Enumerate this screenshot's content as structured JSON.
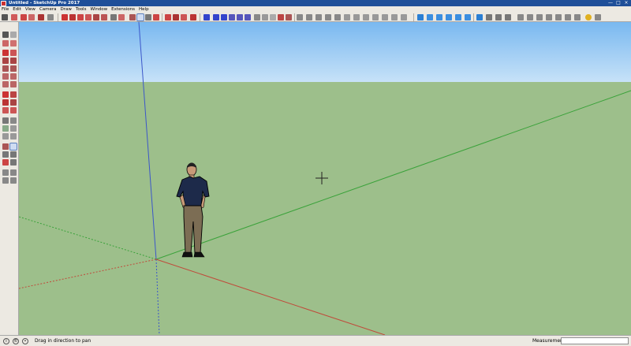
{
  "window": {
    "title": "Untitled - SketchUp Pro 2017",
    "controls": [
      "—",
      "□",
      "×"
    ]
  },
  "menu": [
    "File",
    "Edit",
    "View",
    "Camera",
    "Draw",
    "Tools",
    "Window",
    "Extensions",
    "Help"
  ],
  "toolbar": {
    "selected_tool": "pan-tool"
  },
  "viewport": {
    "sky_color": "#8ec4f2",
    "ground_color": "#9dbf8b",
    "axis_colors": {
      "blue": "#3b56c9",
      "green": "#3aa23a",
      "red": "#c04a3a"
    }
  },
  "status": {
    "message": "Drag in direction to pan",
    "measurements_label": "Measurements",
    "measurements_value": ""
  }
}
